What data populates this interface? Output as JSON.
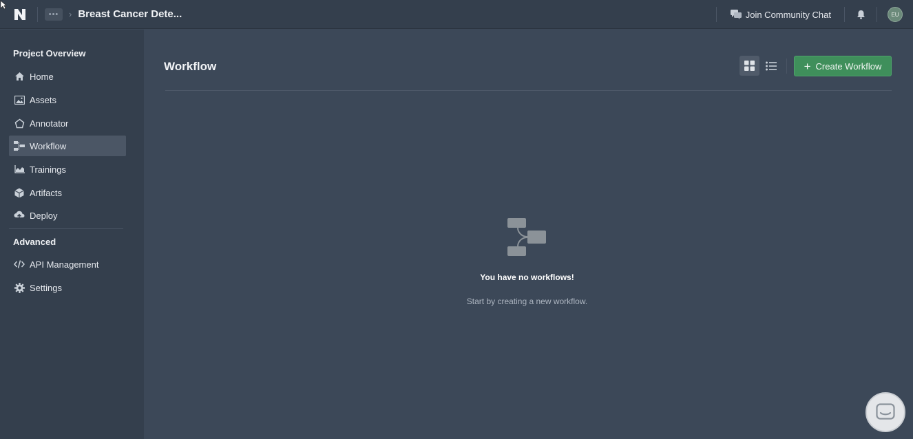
{
  "topbar": {
    "more_label": "•••",
    "project_name": "Breast Cancer Dete...",
    "community_label": "Join Community Chat",
    "avatar_initials": "EU"
  },
  "sidebar": {
    "section_overview": "Project Overview",
    "items": [
      {
        "label": "Home",
        "icon": "home-icon"
      },
      {
        "label": "Assets",
        "icon": "image-icon"
      },
      {
        "label": "Annotator",
        "icon": "polygon-icon"
      },
      {
        "label": "Workflow",
        "icon": "workflow-icon",
        "active": true
      },
      {
        "label": "Trainings",
        "icon": "chart-icon"
      },
      {
        "label": "Artifacts",
        "icon": "cube-icon"
      },
      {
        "label": "Deploy",
        "icon": "cloud-upload-icon"
      }
    ],
    "section_advanced": "Advanced",
    "advanced_items": [
      {
        "label": "API Management",
        "icon": "code-icon"
      },
      {
        "label": "Settings",
        "icon": "gear-icon"
      }
    ]
  },
  "main": {
    "title": "Workflow",
    "create_button": "Create Workflow",
    "empty_title": "You have no workflows!",
    "empty_subtitle": "Start by creating a new workflow."
  },
  "colors": {
    "background": "#3c4858",
    "sidebar": "#343f4d",
    "accent_green": "#3f8f5b"
  }
}
